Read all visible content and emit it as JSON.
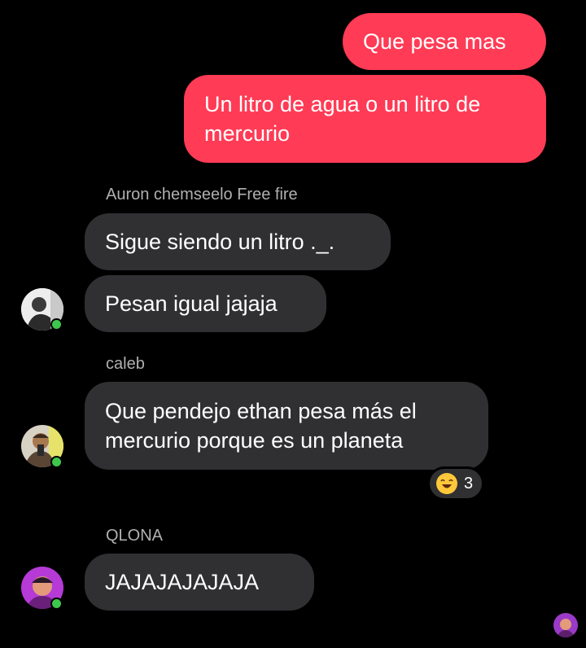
{
  "messages": {
    "m1": "Que pesa mas",
    "m2_line1": "Un litro de agua o un litro de",
    "m2_line2": "mercurio",
    "m3": "Sigue siendo un litro ._.",
    "m4": "Pesan igual jajaja",
    "m5_line1": "Que pendejo ethan pesa más el",
    "m5_line2": "mercurio porque es un planeta",
    "m6": "JAJAJAJAJAJA"
  },
  "senders": {
    "s1": "Auron chemseelo Free fire",
    "s2": "caleb",
    "s3": "QLONA"
  },
  "reaction": {
    "emoji": "laughing-face-icon",
    "count": "3"
  },
  "colors": {
    "outgoing": "#ff3b55",
    "incoming": "#303033",
    "online": "#3ec74d",
    "sender_label": "#b0b0b0"
  }
}
